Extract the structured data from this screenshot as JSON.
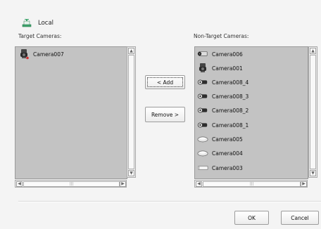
{
  "header": {
    "title": "Local",
    "icon": "local-host-icon"
  },
  "target": {
    "label": "Target Cameras:",
    "items": [
      {
        "label": "Camera007",
        "icon": "camera-dome-icon"
      }
    ]
  },
  "non_target": {
    "label": "Non-Target Cameras:",
    "items": [
      {
        "label": "Camera006",
        "icon": "camera-box-icon"
      },
      {
        "label": "Camera001",
        "icon": "camera-dome-icon"
      },
      {
        "label": "Camera008_4",
        "icon": "camera-bullet-icon"
      },
      {
        "label": "Camera008_3",
        "icon": "camera-bullet-icon"
      },
      {
        "label": "Camera008_2",
        "icon": "camera-bullet-icon"
      },
      {
        "label": "Camera008_1",
        "icon": "camera-bullet-icon"
      },
      {
        "label": "Camera005",
        "icon": "camera-ptz-icon"
      },
      {
        "label": "Camera004",
        "icon": "camera-ptz-icon"
      },
      {
        "label": "Camera003",
        "icon": "camera-flat-icon"
      }
    ]
  },
  "buttons": {
    "add": "< Add",
    "remove": "Remove >",
    "ok": "OK",
    "cancel": "Cancel"
  },
  "scroll": {
    "up": "▲",
    "down": "▼",
    "left": "◀",
    "right": "▶",
    "grip": "|||"
  }
}
